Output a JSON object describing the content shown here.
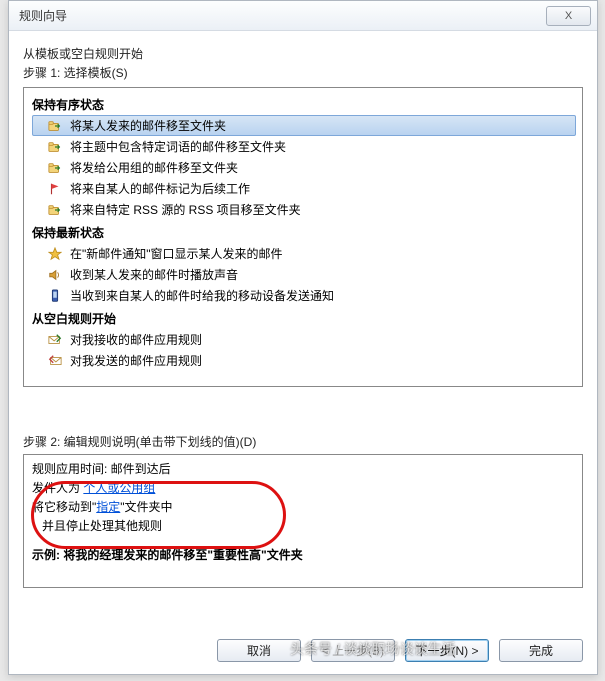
{
  "window": {
    "title": "规则向导",
    "close": "X"
  },
  "intro": "从模板或空白规则开始",
  "step1_label": "步骤 1: 选择模板(S)",
  "groups": [
    {
      "header": "保持有序状态",
      "items": [
        {
          "icon": "folder-move",
          "label": "将某人发来的邮件移至文件夹",
          "selected": true
        },
        {
          "icon": "folder-move",
          "label": "将主题中包含特定词语的邮件移至文件夹"
        },
        {
          "icon": "folder-move",
          "label": "将发给公用组的邮件移至文件夹"
        },
        {
          "icon": "flag",
          "label": "将来自某人的邮件标记为后续工作"
        },
        {
          "icon": "folder-move",
          "label": "将来自特定 RSS 源的 RSS 项目移至文件夹"
        }
      ]
    },
    {
      "header": "保持最新状态",
      "items": [
        {
          "icon": "star",
          "label": "在\"新邮件通知\"窗口显示某人发来的邮件"
        },
        {
          "icon": "sound",
          "label": "收到某人发来的邮件时播放声音"
        },
        {
          "icon": "mobile",
          "label": "当收到来自某人的邮件时给我的移动设备发送通知"
        }
      ]
    },
    {
      "header": "从空白规则开始",
      "items": [
        {
          "icon": "mail-in",
          "label": "对我接收的邮件应用规则"
        },
        {
          "icon": "mail-out",
          "label": "对我发送的邮件应用规则"
        }
      ]
    }
  ],
  "step2_label": "步骤 2: 编辑规则说明(单击带下划线的值)(D)",
  "desc": {
    "line1": "规则应用时间: 邮件到达后",
    "line2_a": "发件人为 ",
    "line2_link": "个人或公用组",
    "line3_a": "将它移动到\"",
    "line3_link": "指定",
    "line3_b": "\"文件夹中",
    "line4": "   并且停止处理其他规则",
    "example": "示例: 将我的经理发来的邮件移至\"重要性高\"文件夹"
  },
  "buttons": {
    "cancel": "取消",
    "back": "< 上一步(B)",
    "next": "下一步(N) >",
    "finish": "完成"
  },
  "watermark": "头条号 / 谈谈职场谈谈生活",
  "icon_svgs": {
    "folder-move": "<svg class='ico' viewBox='0 0 16 16'><rect x='1' y='5' width='11' height='8' rx='1' fill='#f3d47a' stroke='#c09030'/><rect x='1' y='3' width='5' height='3' rx='1' fill='#f3d47a' stroke='#c09030'/><path d='M8 8 L13 8 M11 6 L13 8 L11 10' stroke='#2b7a2b' fill='none' stroke-width='1.4'/></svg>",
    "flag": "<svg class='ico' viewBox='0 0 16 16'><path d='M4 2 v12' stroke='#b03030' stroke-width='1.3'/><path d='M4 2 L12 5 L4 8 Z' fill='#e04040'/></svg>",
    "star": "<svg class='ico' viewBox='0 0 16 16'><path d='M8 1 L10 6 L15 6 L11 9 L12.5 14 L8 11 L3.5 14 L5 9 L1 6 L6 6 Z' fill='#f0c040' stroke='#c09020'/></svg>",
    "sound": "<svg class='ico' viewBox='0 0 16 16'><path d='M2 6 h3 l4 -3 v10 l-4 -3 h-3 Z' fill='#d8a038' stroke='#a07020'/><path d='M11 5 q2 3 0 6' stroke='#a07020' fill='none'/></svg>",
    "mobile": "<svg class='ico' viewBox='0 0 16 16'><rect x='5' y='1' width='6' height='13' rx='1' fill='#3a5db0' stroke='#203a70'/><rect x='6' y='3' width='4' height='7' fill='#bcd4f0'/></svg>",
    "mail-in": "<svg class='ico' viewBox='0 0 16 16'><rect x='1' y='4' width='12' height='8' fill='#fff' stroke='#b89040'/><path d='M1 4 L7 9 L13 4' stroke='#b89040' fill='none'/><path d='M10 2 L14 6 L10 10' stroke='#2b7a2b' fill='none' stroke-width='1.5'/></svg>",
    "mail-out": "<svg class='ico' viewBox='0 0 16 16'><rect x='3' y='4' width='12' height='8' fill='#fff' stroke='#b89040'/><path d='M3 4 L9 9 L15 4' stroke='#b89040' fill='none'/><path d='M6 2 L2 6 L6 10' stroke='#c04040' fill='none' stroke-width='1.5'/></svg>"
  }
}
